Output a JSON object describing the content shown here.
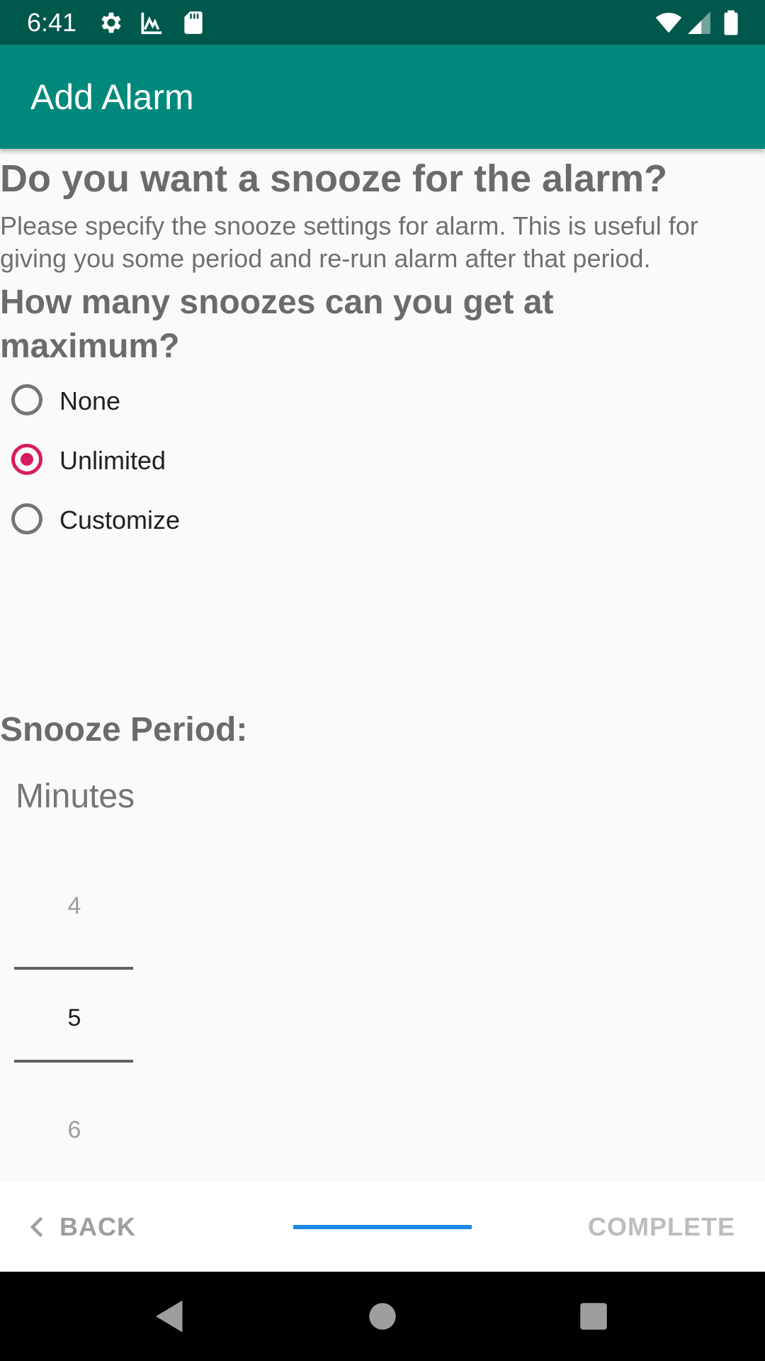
{
  "status_bar": {
    "time": "6:41",
    "icons": [
      "settings-icon",
      "signal-chart-icon",
      "sd-card-icon",
      "wifi-icon",
      "cell-signal-icon",
      "battery-icon"
    ]
  },
  "app_bar": {
    "title": "Add Alarm",
    "color": "#00897b"
  },
  "content": {
    "title": "Do you want a snooze for the alarm?",
    "description": "Please specify the snooze settings for alarm. This is useful for giving you some period and re-run alarm after that period.",
    "count_question": "How many snoozes can you get at maximum?",
    "options": [
      {
        "label": "None",
        "checked": false
      },
      {
        "label": "Unlimited",
        "checked": true
      },
      {
        "label": "Customize",
        "checked": false
      }
    ],
    "period_label": "Snooze Period:",
    "minutes_label": "Minutes",
    "picker": {
      "prev": "4",
      "selected": "5",
      "next": "6"
    }
  },
  "stepper": {
    "back_label": "BACK",
    "complete_label": "COMPLETE",
    "progress": 1.0,
    "accent": "#1e88e5"
  },
  "nav_bar": {
    "icons": [
      "back-triangle-icon",
      "home-circle-icon",
      "recents-square-icon"
    ]
  }
}
